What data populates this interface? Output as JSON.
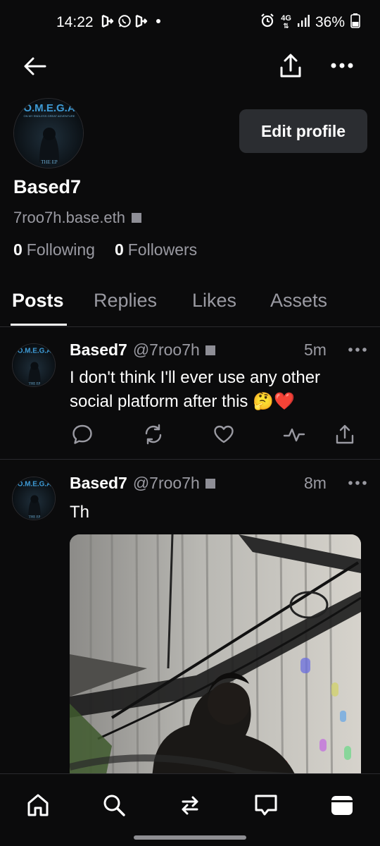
{
  "status_bar": {
    "time": "14:22",
    "battery": "36%",
    "network": "4G"
  },
  "profile": {
    "avatar_title": "O.M.E.G.A",
    "avatar_subtitle": "ON MY ENDLESS GREAT ADVENTURE",
    "avatar_footer": "THE EP",
    "edit_label": "Edit profile",
    "display_name": "Based7",
    "handle": "7roo7h.base.eth",
    "following_count": "0",
    "following_label": "Following",
    "followers_count": "0",
    "followers_label": "Followers"
  },
  "tabs": [
    {
      "label": "Posts",
      "active": true
    },
    {
      "label": "Replies",
      "active": false
    },
    {
      "label": "Likes",
      "active": false
    },
    {
      "label": "Assets",
      "active": false
    }
  ],
  "posts": [
    {
      "name": "Based7",
      "handle": "@7roo7h",
      "time": "5m",
      "text": "I don't think I'll ever use any other social platform after this",
      "emojis": "🤔❤️"
    },
    {
      "name": "Based7",
      "handle": "@7roo7h",
      "time": "8m",
      "text": "Th"
    }
  ],
  "icons": {
    "back": "arrow-left-icon",
    "share": "share-icon",
    "more": "more-horizontal-icon",
    "reply": "reply-icon",
    "repost": "repost-icon",
    "like": "heart-icon",
    "activity": "activity-icon",
    "home": "home-icon",
    "search": "search-icon",
    "swap": "swap-icon",
    "messages": "chat-icon",
    "wallet": "wallet-icon"
  },
  "colors": {
    "background": "#0b0b0c",
    "secondary_text": "#9a9aa2",
    "button_bg": "#2b2d31"
  }
}
